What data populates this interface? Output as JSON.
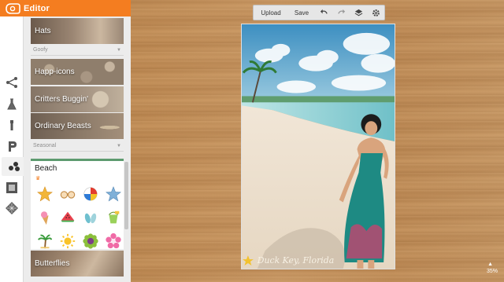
{
  "app": {
    "title": "Editor"
  },
  "rail": {
    "items": [
      {
        "name": "edit-icon"
      },
      {
        "name": "effects-icon"
      },
      {
        "name": "touch-up-icon"
      },
      {
        "name": "text-icon"
      },
      {
        "name": "overlays-icon"
      },
      {
        "name": "frames-icon"
      },
      {
        "name": "textures-icon"
      }
    ]
  },
  "panel": {
    "tiles": [
      {
        "label": "Hats"
      },
      {
        "label": "Happ-icons"
      },
      {
        "label": "Critters Buggin'"
      },
      {
        "label": "Ordinary Beasts"
      },
      {
        "label": "Butterflies"
      }
    ],
    "sections": [
      {
        "label": "Goofy"
      },
      {
        "label": "Seasonal"
      }
    ],
    "open_group": {
      "label": "Beach",
      "stickers": [
        "starfish-icon",
        "sunglasses-icon",
        "beach-ball-icon",
        "blue-starfish-icon",
        "ice-cream-icon",
        "watermelon-icon",
        "flip-flops-icon",
        "bucket-icon",
        "palm-tree-icon",
        "sun-icon",
        "sunflower-icon",
        "hibiscus-icon"
      ]
    }
  },
  "toolbar": {
    "upload_label": "Upload",
    "save_label": "Save",
    "icons": [
      "undo-icon",
      "redo-icon",
      "layers-icon",
      "settings-icon"
    ]
  },
  "photo": {
    "caption": "Duck Key, Florida"
  },
  "zoom": {
    "label": "35%"
  },
  "colors": {
    "brand": "#f47d20",
    "beach_accent": "#5d9a6f"
  }
}
